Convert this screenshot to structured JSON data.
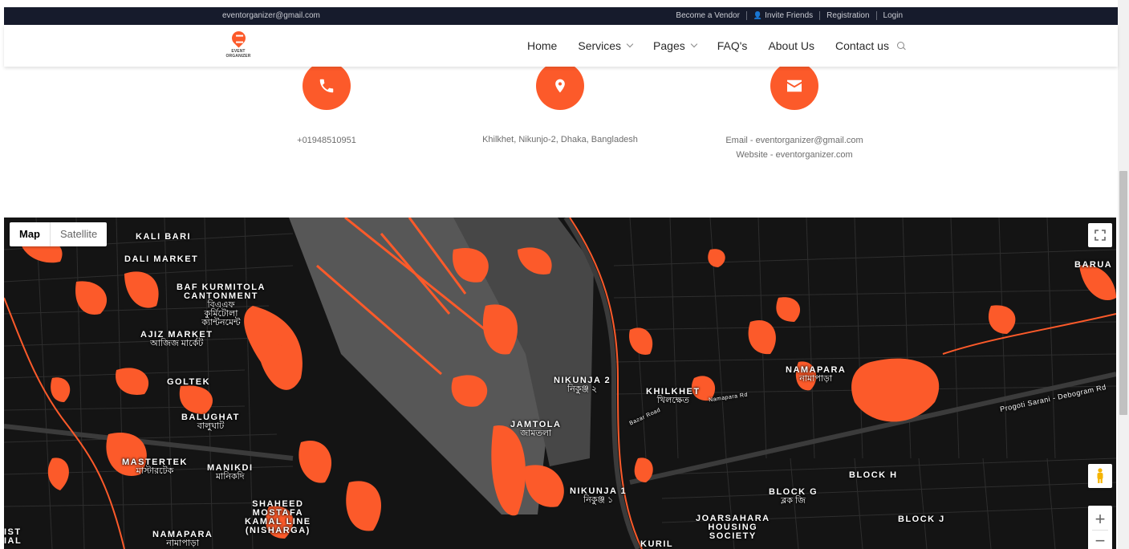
{
  "topbar": {
    "email": "eventorganizer@gmail.com",
    "links": [
      "Become a Vendor",
      "Invite Friends",
      "Registration",
      "Login"
    ]
  },
  "logo": {
    "text": "EVENT ORGANIZER"
  },
  "nav": {
    "items": [
      {
        "label": "Home",
        "dropdown": false
      },
      {
        "label": "Services",
        "dropdown": true
      },
      {
        "label": "Pages",
        "dropdown": true
      },
      {
        "label": "FAQ's",
        "dropdown": false
      },
      {
        "label": "About Us",
        "dropdown": false
      },
      {
        "label": "Contact us",
        "dropdown": false
      }
    ]
  },
  "contact": {
    "phone": "+01948510951",
    "address": "Khilkhet, Nikunjo-2, Dhaka, Bangladesh",
    "email_line": "Email - eventorganizer@gmail.com",
    "website_line": "Website - eventorganizer.com",
    "accent": "#fc5a2a",
    "icons": [
      "phone-icon",
      "map-pin-icon",
      "envelope-icon"
    ]
  },
  "map": {
    "type_buttons": {
      "map": "Map",
      "satellite": "Satellite"
    },
    "labels": {
      "kali_bari": "KALI BARI",
      "dali_market": "DALI MARKET",
      "baf": "BAF KURMITOLA",
      "cantonment": "CANTONMENT",
      "baf_bn1": "বিএএফ",
      "baf_bn2": "কুর্মিটোলা",
      "baf_bn3": "ক্যান্টনমেন্ট",
      "ajiz": "AJIZ MARKET",
      "ajiz_bn": "আজিজ মার্কেট",
      "goltek": "GOLTEK",
      "balughat": "BALUGHAT",
      "balughat_bn": "বালুঘাট",
      "mastertek": "MASTERTEK",
      "mastertek_bn": "মাস্টারটেক",
      "manikdi": "MANIKDI",
      "manikdi_bn": "মানিকদি",
      "shaheed1": "SHAHEED",
      "shaheed2": "MOSTAFA",
      "shaheed3": "KAMAL LINE",
      "shaheed4": "(NISHARGA)",
      "namapara_w": "NAMAPARA",
      "namapara_w_bn": "নামাপাড়া",
      "nikunja2": "NIKUNJA 2",
      "nikunja2_bn": "নিকুঞ্জ ২",
      "jamtola": "JAMTOLA",
      "jamtola_bn": "জামতলা",
      "khilkhet": "KHILKHET",
      "khilkhet_bn": "খিলক্ষেত",
      "namapara_e": "NAMAPARA",
      "namapara_e_bn": "নামাপাড়া",
      "nikunja1": "NIKUNJA 1",
      "nikunja1_bn": "নিকুঞ্জ ১",
      "block_g": "BLOCK G",
      "block_g_bn": "ব্লক জি",
      "block_h": "BLOCK H",
      "block_j": "BLOCK J",
      "joarsahara1": "JOARSAHARA",
      "joarsahara2": "HOUSING",
      "joarsahara3": "SOCIETY",
      "barua": "BARUA",
      "kuril": "KURIL",
      "progoti": "Progoti Sarani - Debogram Rd",
      "namapara_rd": "Namapara Rd",
      "bazar_rd": "Bazar Road",
      "ist": "IST",
      "ial": "IAL"
    },
    "controls": {
      "zoom_in": "+",
      "zoom_out": "−"
    },
    "water_color": "#fc5a2a",
    "land_color": "#141414",
    "runway_color": "#5a5a5a"
  }
}
